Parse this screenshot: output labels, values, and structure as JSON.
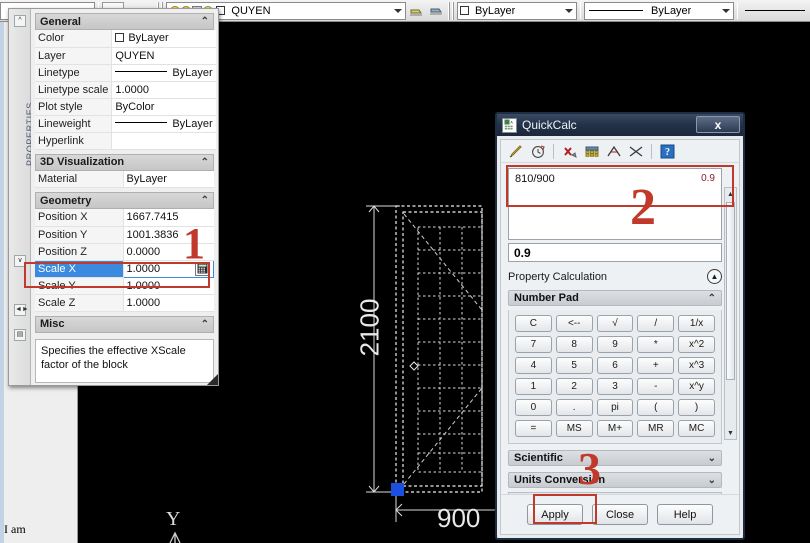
{
  "toolbar": {
    "layer_combo_value": "QUYEN",
    "color_combo_value": "ByLayer",
    "linetype_combo_value": "ByLayer",
    "icons": [
      "layer-bulb-icon",
      "layer-freeze-icon",
      "layer-lock-icon",
      "layer-plot-icon",
      "layer-previous-icon",
      "layer-properties-icon"
    ]
  },
  "properties_palette": {
    "tab_label": "PROPERTIES",
    "sections": {
      "general": {
        "title": "General",
        "rows": [
          {
            "key": "Color",
            "value": "ByLayer",
            "kind": "color"
          },
          {
            "key": "Layer",
            "value": "QUYEN",
            "kind": "text"
          },
          {
            "key": "Linetype",
            "value": "ByLayer",
            "kind": "line"
          },
          {
            "key": "Linetype scale",
            "value": "1.0000",
            "kind": "text"
          },
          {
            "key": "Plot style",
            "value": "ByColor",
            "kind": "text"
          },
          {
            "key": "Lineweight",
            "value": "ByLayer",
            "kind": "line"
          },
          {
            "key": "Hyperlink",
            "value": "",
            "kind": "text"
          }
        ]
      },
      "visualization3d": {
        "title": "3D Visualization",
        "rows": [
          {
            "key": "Material",
            "value": "ByLayer",
            "kind": "text"
          }
        ]
      },
      "geometry": {
        "title": "Geometry",
        "rows": [
          {
            "key": "Position X",
            "value": "1667.7415",
            "kind": "text"
          },
          {
            "key": "Position Y",
            "value": "1001.3836",
            "kind": "text"
          },
          {
            "key": "Position Z",
            "value": "0.0000",
            "kind": "text"
          },
          {
            "key": "Scale X",
            "value": "1.0000",
            "kind": "selected"
          },
          {
            "key": "Scale Y",
            "value": "1.0000",
            "kind": "text"
          },
          {
            "key": "Scale Z",
            "value": "1.0000",
            "kind": "text"
          }
        ]
      },
      "misc": {
        "title": "Misc",
        "help_text": "Specifies the effective XScale factor of the block"
      }
    }
  },
  "quickcalc": {
    "title": "QuickCalc",
    "close_label": "x",
    "toolbar_icons": [
      "clear-icon",
      "clear-history-icon",
      "paste-to-command-line-icon",
      "get-coordinates-icon",
      "distance-between-points-icon",
      "angle-of-line-icon",
      "intersection-of-lines-icon",
      "help-icon"
    ],
    "expression": "810/900",
    "expression_result_inline": "0.9",
    "result": "0.9",
    "property_calculation_label": "Property Calculation",
    "number_pad_label": "Number Pad",
    "number_pad_keys": [
      "C",
      "<--",
      "√",
      "/",
      "1/x",
      "7",
      "8",
      "9",
      "*",
      "x^2",
      "4",
      "5",
      "6",
      "+",
      "x^3",
      "1",
      "2",
      "3",
      "-",
      "x^y",
      "0",
      ".",
      "pi",
      "(",
      ")",
      "=",
      "MS",
      "M+",
      "MR",
      "MC"
    ],
    "scientific_label": "Scientific",
    "units_conversion_label": "Units Conversion",
    "buttons": [
      "Apply",
      "Close",
      "Help"
    ]
  },
  "drawing": {
    "dimension_vertical": "2100",
    "dimension_horizontal": "900",
    "ucs_y_label": "Y",
    "grip_color": "#1a4fe0"
  },
  "annotations": {
    "markers": [
      "1",
      "2",
      "3"
    ],
    "color": "#c0392b"
  },
  "statusbar": {
    "text": "I am"
  }
}
